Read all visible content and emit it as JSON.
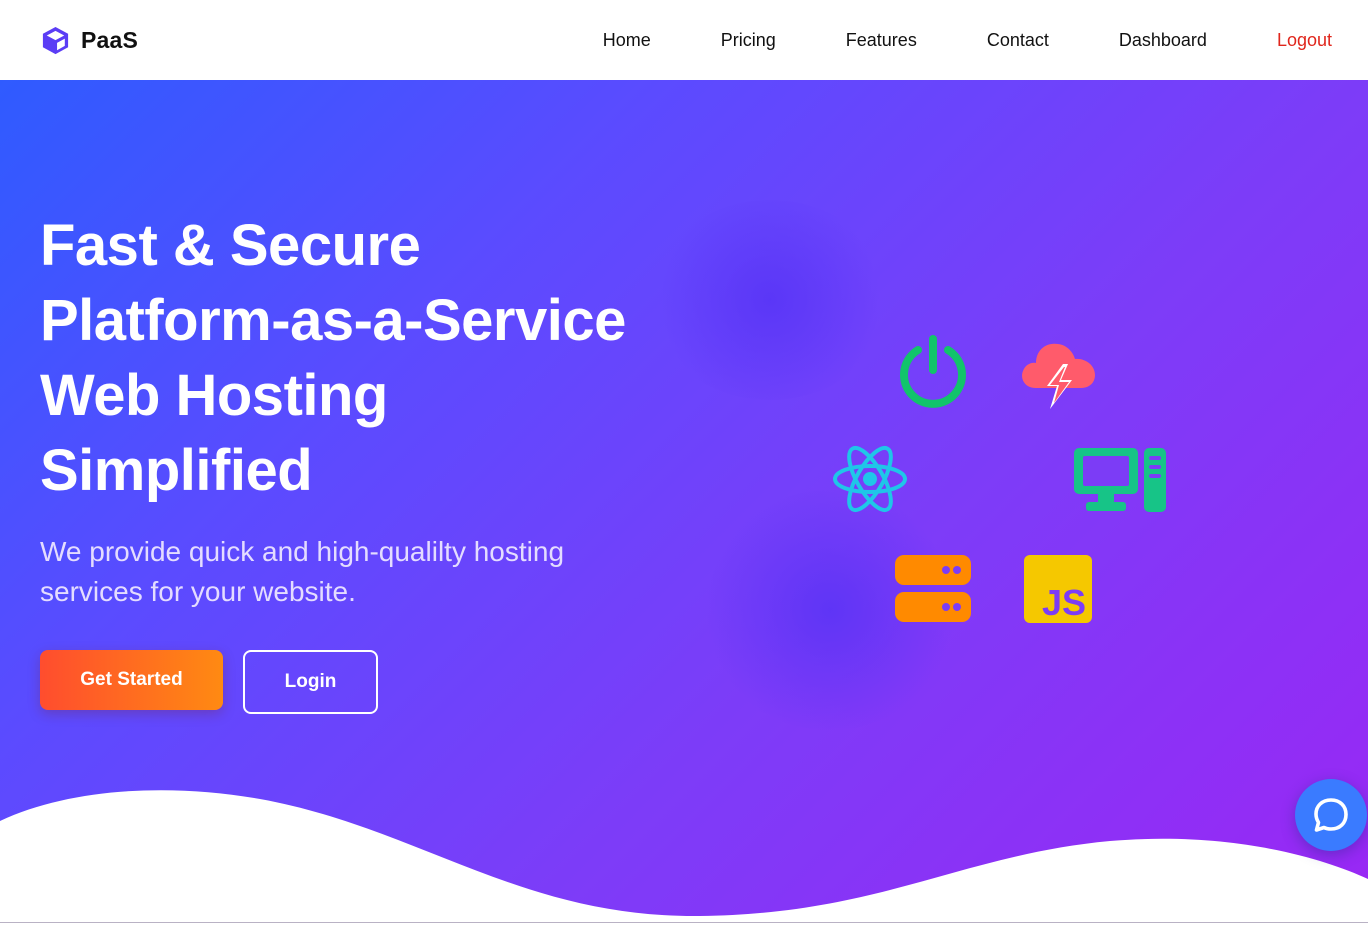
{
  "brand": {
    "name": "PaaS",
    "logo_icon": "cube-icon",
    "logo_color": "#5b3df5"
  },
  "nav": {
    "items": [
      {
        "label": "Home"
      },
      {
        "label": "Pricing"
      },
      {
        "label": "Features"
      },
      {
        "label": "Contact"
      },
      {
        "label": "Dashboard"
      },
      {
        "label": "Logout"
      }
    ],
    "logout_color": "#e0261c"
  },
  "hero": {
    "title_lines": [
      "Fast & Secure",
      "Platform-as-a-Service",
      "Web Hosting",
      "Simplified"
    ],
    "subtitle_lines": [
      "We provide quick and high-qualilty hosting",
      "services for your website."
    ],
    "primary_button": "Get Started",
    "secondary_button": "Login",
    "background_colors": [
      "#2f5bff",
      "#7d3cf8",
      "#9a27f4"
    ]
  },
  "tech_icons": [
    {
      "icon": "power-icon",
      "color": "#12c46b"
    },
    {
      "icon": "cloud-lightning-icon",
      "color": "#ff5b6b"
    },
    {
      "icon": "react-icon",
      "color": "#1fc6e8"
    },
    {
      "icon": "desktop-computer-icon",
      "color": "#17c487"
    },
    {
      "icon": "server-icon",
      "color": "#ff8a00"
    },
    {
      "icon": "javascript-icon",
      "label": "JS",
      "color": "#f5c800"
    }
  ],
  "chat": {
    "icon": "chat-bubble-icon",
    "color": "#3a7bff"
  }
}
